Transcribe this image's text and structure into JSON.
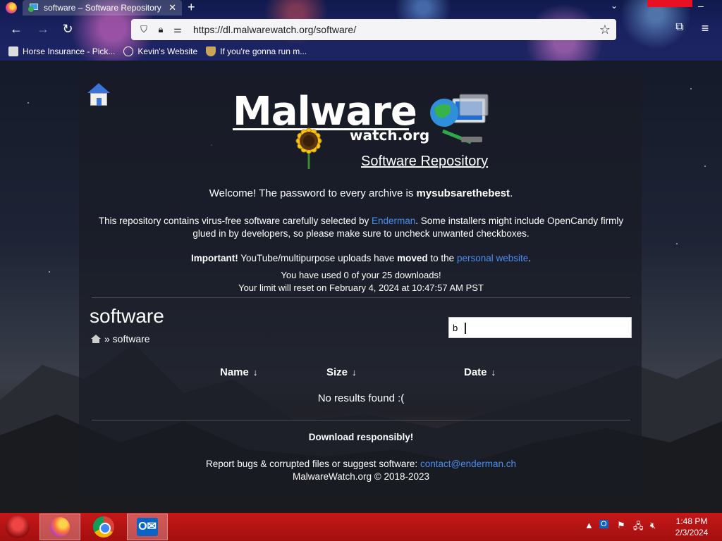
{
  "browser": {
    "tab_title": "software – Software Repository",
    "tab_close": "✕",
    "new_tab": "+",
    "url": "https://dl.malwarewatch.org/software/",
    "bookmarks": [
      {
        "label": "Horse Insurance - Pick..."
      },
      {
        "label": "Kevin's Website"
      },
      {
        "label": "If you're gonna run m..."
      }
    ]
  },
  "page": {
    "logo": {
      "main": "Malware",
      "sub": "watch.org",
      "tagline": "Software Repository"
    },
    "welcome": {
      "prefix": "Welcome! The password to every archive is ",
      "password": "mysubsarethebest",
      "suffix": "."
    },
    "description": {
      "before": "This repository contains virus-free software carefully selected by ",
      "link": "Enderman",
      "after": ". Some installers might include OpenCandy firmly glued in by developers, so please make sure to uncheck unwanted checkboxes."
    },
    "important": {
      "label": "Important!",
      "text1": " YouTube/multipurpose uploads have ",
      "moved": "moved",
      "text2": " to the ",
      "link": "personal website",
      "end": "."
    },
    "quota": {
      "used": "You have used 0 of your 25 downloads!",
      "reset": "Your limit will reset on February 4, 2024 at 10:47:57 AM PST"
    },
    "heading": "software",
    "breadcrumb": "» software",
    "search": {
      "value": "b"
    },
    "columns": [
      {
        "label": "Name",
        "arrow": "↓"
      },
      {
        "label": "Size",
        "arrow": "↓"
      },
      {
        "label": "Date",
        "arrow": "↓"
      }
    ],
    "no_results": "No results found :(",
    "footer": {
      "tagline": "Download responsibly!",
      "report": "Report bugs & corrupted files or suggest software: ",
      "email": "contact@enderman.ch",
      "copyright": "MalwareWatch.org © 2018-2023"
    }
  },
  "taskbar": {
    "apps": [
      "firefox",
      "chrome",
      "outlook"
    ],
    "clock": {
      "time": "1:48 PM",
      "date": "2/3/2024"
    }
  }
}
